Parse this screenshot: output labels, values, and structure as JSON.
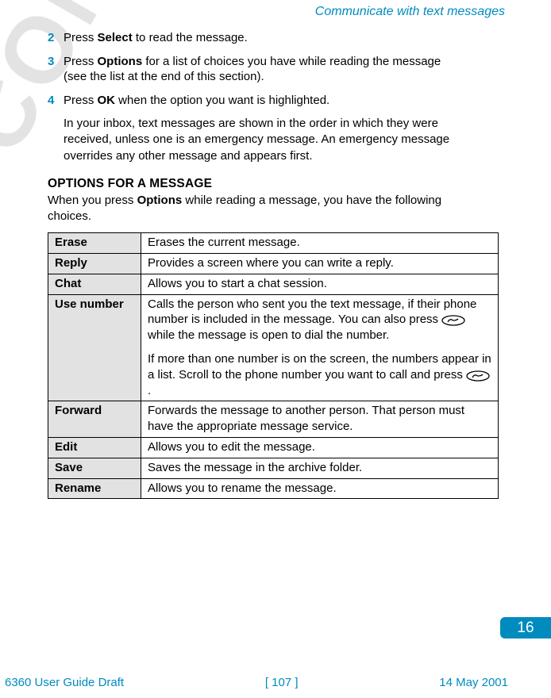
{
  "header": {
    "title": "Communicate with text messages"
  },
  "watermark": "CONFIDENTIAL",
  "steps": [
    {
      "num": "2",
      "parts": [
        "Press ",
        "Select",
        " to read the message."
      ]
    },
    {
      "num": "3",
      "parts": [
        "Press ",
        "Options",
        " for a list of choices you have while reading the message (see the list at the end of this section)."
      ]
    },
    {
      "num": "4",
      "parts": [
        "Press ",
        "OK",
        " when the option you want is highlighted."
      ]
    }
  ],
  "note": "In your inbox, text messages are shown in the order in which they were received, unless one is an emergency message. An emergency message overrides any other message and appears first.",
  "subhead": "OPTIONS FOR A MESSAGE",
  "options_intro": {
    "parts": [
      "When you press ",
      "Options",
      " while reading a message, you have the following choices."
    ]
  },
  "table": {
    "rows": [
      {
        "label": "Erase",
        "desc": "Erases the current message."
      },
      {
        "label": "Reply",
        "desc": "Provides a screen where you can write a reply."
      },
      {
        "label": "Chat",
        "desc": "Allows you to start a chat session."
      },
      {
        "label": "Use number",
        "desc_p1a": "Calls the person who sent you the text message, if their phone number is included in the message. You can also press ",
        "desc_p1b": " while the message is open to dial the number.",
        "desc_p2a": "If more than one number is on the screen, the numbers appear in a list. Scroll to the phone number you want to call and press ",
        "desc_p2b": "."
      },
      {
        "label": "Forward",
        "desc": "Forwards the message to another person. That person must have the appropriate message service."
      },
      {
        "label": "Edit",
        "desc": "Allows you to edit the message."
      },
      {
        "label": "Save",
        "desc": "Saves the message in the archive folder."
      },
      {
        "label": "Rename",
        "desc": "Allows you to rename the message."
      }
    ]
  },
  "badge": "16",
  "footer": {
    "left": "6360 User Guide Draft",
    "center": "[ 107 ]",
    "right": "14 May 2001"
  }
}
